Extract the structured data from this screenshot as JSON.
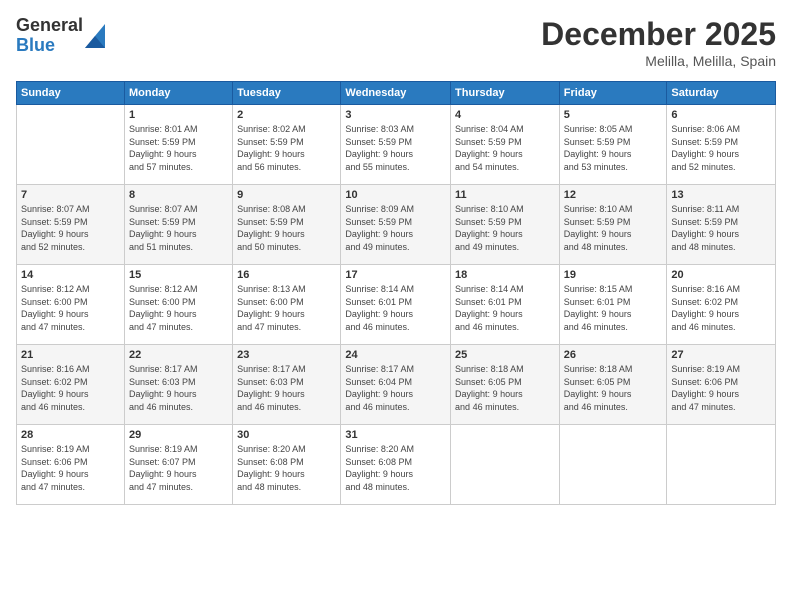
{
  "logo": {
    "general": "General",
    "blue": "Blue"
  },
  "header": {
    "month": "December 2025",
    "location": "Melilla, Melilla, Spain"
  },
  "weekdays": [
    "Sunday",
    "Monday",
    "Tuesday",
    "Wednesday",
    "Thursday",
    "Friday",
    "Saturday"
  ],
  "weeks": [
    [
      {
        "day": "",
        "info": ""
      },
      {
        "day": "1",
        "info": "Sunrise: 8:01 AM\nSunset: 5:59 PM\nDaylight: 9 hours\nand 57 minutes."
      },
      {
        "day": "2",
        "info": "Sunrise: 8:02 AM\nSunset: 5:59 PM\nDaylight: 9 hours\nand 56 minutes."
      },
      {
        "day": "3",
        "info": "Sunrise: 8:03 AM\nSunset: 5:59 PM\nDaylight: 9 hours\nand 55 minutes."
      },
      {
        "day": "4",
        "info": "Sunrise: 8:04 AM\nSunset: 5:59 PM\nDaylight: 9 hours\nand 54 minutes."
      },
      {
        "day": "5",
        "info": "Sunrise: 8:05 AM\nSunset: 5:59 PM\nDaylight: 9 hours\nand 53 minutes."
      },
      {
        "day": "6",
        "info": "Sunrise: 8:06 AM\nSunset: 5:59 PM\nDaylight: 9 hours\nand 52 minutes."
      }
    ],
    [
      {
        "day": "7",
        "info": "Sunrise: 8:07 AM\nSunset: 5:59 PM\nDaylight: 9 hours\nand 52 minutes."
      },
      {
        "day": "8",
        "info": "Sunrise: 8:07 AM\nSunset: 5:59 PM\nDaylight: 9 hours\nand 51 minutes."
      },
      {
        "day": "9",
        "info": "Sunrise: 8:08 AM\nSunset: 5:59 PM\nDaylight: 9 hours\nand 50 minutes."
      },
      {
        "day": "10",
        "info": "Sunrise: 8:09 AM\nSunset: 5:59 PM\nDaylight: 9 hours\nand 49 minutes."
      },
      {
        "day": "11",
        "info": "Sunrise: 8:10 AM\nSunset: 5:59 PM\nDaylight: 9 hours\nand 49 minutes."
      },
      {
        "day": "12",
        "info": "Sunrise: 8:10 AM\nSunset: 5:59 PM\nDaylight: 9 hours\nand 48 minutes."
      },
      {
        "day": "13",
        "info": "Sunrise: 8:11 AM\nSunset: 5:59 PM\nDaylight: 9 hours\nand 48 minutes."
      }
    ],
    [
      {
        "day": "14",
        "info": "Sunrise: 8:12 AM\nSunset: 6:00 PM\nDaylight: 9 hours\nand 47 minutes."
      },
      {
        "day": "15",
        "info": "Sunrise: 8:12 AM\nSunset: 6:00 PM\nDaylight: 9 hours\nand 47 minutes."
      },
      {
        "day": "16",
        "info": "Sunrise: 8:13 AM\nSunset: 6:00 PM\nDaylight: 9 hours\nand 47 minutes."
      },
      {
        "day": "17",
        "info": "Sunrise: 8:14 AM\nSunset: 6:01 PM\nDaylight: 9 hours\nand 46 minutes."
      },
      {
        "day": "18",
        "info": "Sunrise: 8:14 AM\nSunset: 6:01 PM\nDaylight: 9 hours\nand 46 minutes."
      },
      {
        "day": "19",
        "info": "Sunrise: 8:15 AM\nSunset: 6:01 PM\nDaylight: 9 hours\nand 46 minutes."
      },
      {
        "day": "20",
        "info": "Sunrise: 8:16 AM\nSunset: 6:02 PM\nDaylight: 9 hours\nand 46 minutes."
      }
    ],
    [
      {
        "day": "21",
        "info": "Sunrise: 8:16 AM\nSunset: 6:02 PM\nDaylight: 9 hours\nand 46 minutes."
      },
      {
        "day": "22",
        "info": "Sunrise: 8:17 AM\nSunset: 6:03 PM\nDaylight: 9 hours\nand 46 minutes."
      },
      {
        "day": "23",
        "info": "Sunrise: 8:17 AM\nSunset: 6:03 PM\nDaylight: 9 hours\nand 46 minutes."
      },
      {
        "day": "24",
        "info": "Sunrise: 8:17 AM\nSunset: 6:04 PM\nDaylight: 9 hours\nand 46 minutes."
      },
      {
        "day": "25",
        "info": "Sunrise: 8:18 AM\nSunset: 6:05 PM\nDaylight: 9 hours\nand 46 minutes."
      },
      {
        "day": "26",
        "info": "Sunrise: 8:18 AM\nSunset: 6:05 PM\nDaylight: 9 hours\nand 46 minutes."
      },
      {
        "day": "27",
        "info": "Sunrise: 8:19 AM\nSunset: 6:06 PM\nDaylight: 9 hours\nand 47 minutes."
      }
    ],
    [
      {
        "day": "28",
        "info": "Sunrise: 8:19 AM\nSunset: 6:06 PM\nDaylight: 9 hours\nand 47 minutes."
      },
      {
        "day": "29",
        "info": "Sunrise: 8:19 AM\nSunset: 6:07 PM\nDaylight: 9 hours\nand 47 minutes."
      },
      {
        "day": "30",
        "info": "Sunrise: 8:20 AM\nSunset: 6:08 PM\nDaylight: 9 hours\nand 48 minutes."
      },
      {
        "day": "31",
        "info": "Sunrise: 8:20 AM\nSunset: 6:08 PM\nDaylight: 9 hours\nand 48 minutes."
      },
      {
        "day": "",
        "info": ""
      },
      {
        "day": "",
        "info": ""
      },
      {
        "day": "",
        "info": ""
      }
    ]
  ]
}
